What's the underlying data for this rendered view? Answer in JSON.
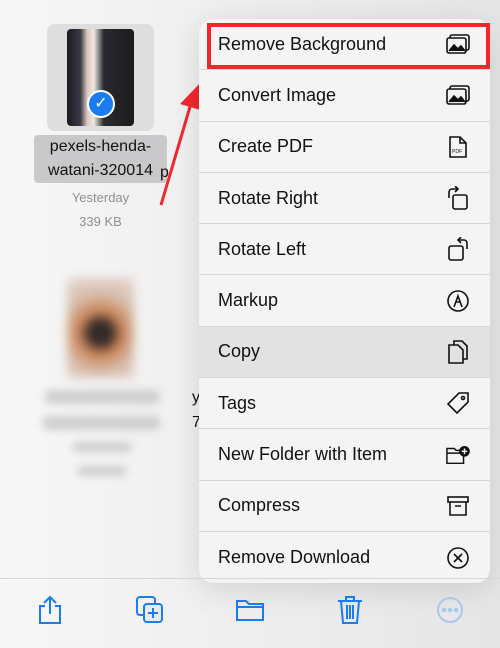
{
  "file": {
    "name": "pexels-henda-watani-320014",
    "date": "Yesterday",
    "size": "339 KB",
    "selected": true
  },
  "partial_fragments": [
    "p",
    "y",
    "7"
  ],
  "menu": {
    "highlighted": "Copy",
    "items": [
      {
        "label": "Remove Background",
        "icon": "photo-background-icon"
      },
      {
        "label": "Convert Image",
        "icon": "photo-icon"
      },
      {
        "label": "Create PDF",
        "icon": "pdf-doc-icon"
      },
      {
        "label": "Rotate Right",
        "icon": "rotate-right-icon"
      },
      {
        "label": "Rotate Left",
        "icon": "rotate-left-icon"
      },
      {
        "label": "Markup",
        "icon": "markup-pen-icon"
      },
      {
        "label": "Copy",
        "icon": "copy-doc-icon"
      },
      {
        "label": "Tags",
        "icon": "tag-icon"
      },
      {
        "label": "New Folder with Item",
        "icon": "folder-plus-icon"
      },
      {
        "label": "Compress",
        "icon": "archive-box-icon"
      },
      {
        "label": "Remove Download",
        "icon": "x-circle-icon"
      }
    ]
  },
  "toolbar": [
    "share-icon",
    "duplicate-icon",
    "folder-icon",
    "trash-icon",
    "more-icon"
  ],
  "colors": {
    "accent": "#1a7cf0",
    "annotation": "#f0282e"
  }
}
